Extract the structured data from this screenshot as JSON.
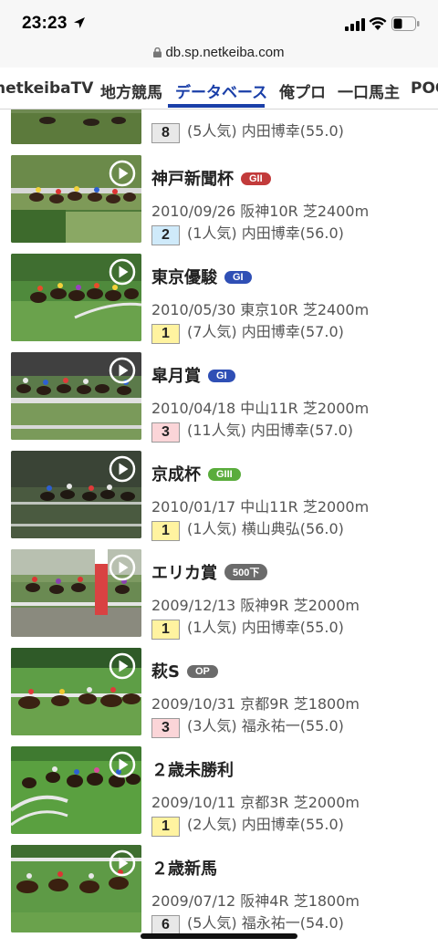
{
  "status_bar": {
    "time": "23:23"
  },
  "url_bar": {
    "url": "db.sp.netkeiba.com"
  },
  "nav": {
    "items": [
      {
        "label": "netkeibaTV"
      },
      {
        "label": "地方競馬"
      },
      {
        "label": "データベース"
      },
      {
        "label": "俺プロ"
      },
      {
        "label": "一口馬主"
      },
      {
        "label": "POG"
      }
    ],
    "active_index": 2,
    "accent_color": "#1a3fa8"
  },
  "races": [
    {
      "name": "",
      "grade": "",
      "meta": "",
      "rank": "8",
      "rank_color": "#e8e8e8",
      "result": "(5人気) 内田博幸(55.0)"
    },
    {
      "name": "神戸新聞杯",
      "grade": "GII",
      "grade_color": "#c23b3b",
      "meta": "2010/09/26 阪神10R 芝2400m",
      "rank": "2",
      "rank_color": "#cfeafa",
      "result": "(1人気) 内田博幸(56.0)"
    },
    {
      "name": "東京優駿",
      "grade": "GI",
      "grade_color": "#2f4fb5",
      "meta": "2010/05/30 東京10R 芝2400m",
      "rank": "1",
      "rank_color": "#fff3a0",
      "result": "(7人気) 内田博幸(57.0)"
    },
    {
      "name": "皐月賞",
      "grade": "GI",
      "grade_color": "#2f4fb5",
      "meta": "2010/04/18 中山11R 芝2000m",
      "rank": "3",
      "rank_color": "#fbd5d8",
      "result": "(11人気) 内田博幸(57.0)"
    },
    {
      "name": "京成杯",
      "grade": "GIII",
      "grade_color": "#5aac3c",
      "meta": "2010/01/17 中山11R 芝2000m",
      "rank": "1",
      "rank_color": "#fff3a0",
      "result": "(1人気) 横山典弘(56.0)"
    },
    {
      "name": "エリカ賞",
      "grade": "500下",
      "grade_color": "#6b6b6b",
      "meta": "2009/12/13 阪神9R 芝2000m",
      "rank": "1",
      "rank_color": "#fff3a0",
      "result": "(1人気) 内田博幸(55.0)"
    },
    {
      "name": "萩S",
      "grade": "OP",
      "grade_color": "#6b6b6b",
      "meta": "2009/10/31 京都9R 芝1800m",
      "rank": "3",
      "rank_color": "#fbd5d8",
      "result": "(3人気) 福永祐一(55.0)"
    },
    {
      "name": "２歳未勝利",
      "grade": "",
      "meta": "2009/10/11 京都3R 芝2000m",
      "rank": "1",
      "rank_color": "#fff3a0",
      "result": "(2人気) 内田博幸(55.0)"
    },
    {
      "name": "２歳新馬",
      "grade": "",
      "meta": "2009/07/12 阪神4R 芝1800m",
      "rank": "6",
      "rank_color": "#e8e8e8",
      "result": "(5人気) 福永祐一(54.0)"
    }
  ]
}
